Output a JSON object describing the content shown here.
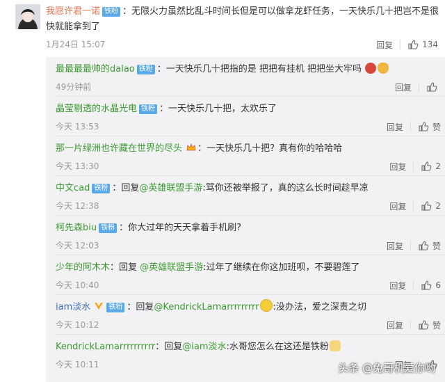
{
  "main": {
    "user": "我愿许君一诺",
    "badge": "铁粉",
    "text": "：无限火力虽然比乱斗时间长但是可以做拿龙虾任务，一天快乐几十把岂不是很快就能拿到了",
    "time": "1月24日 15:07",
    "reply": "回复",
    "likes": "134"
  },
  "replies": [
    {
      "user": "最最最最帅的dalao",
      "badge": "铁粉",
      "text": "：一天快乐几十把指的是 把把有挂机 把把坐大牢吗",
      "time": "49分钟前",
      "reply": "回复",
      "likes": ""
    },
    {
      "user": "晶莹剔透的水晶光电",
      "badge": "铁粉",
      "text": "：一天快乐几十把，太欢乐了",
      "time": "今天 13:53",
      "reply": "回复",
      "likes": "赞"
    },
    {
      "user": "那一片绿洲也许藏在世界的尽头",
      "badge": "",
      "text": "：一天快乐几十把？真有你的哈哈哈",
      "time": "今天 13:30",
      "reply": "回复",
      "likes": "2"
    },
    {
      "user": "中文cad",
      "badge": "铁粉",
      "pre": "：回复",
      "mention": "@英雄联盟手游",
      "text": ":骂你还被举报了，真的这么长时间趁早凉",
      "time": "今天 12:38",
      "reply": "回复",
      "likes": "2"
    },
    {
      "user": "柯先森biu",
      "badge": "铁粉",
      "text": "：你大过年的天天拿着手机刷?",
      "time": "今天 12:03",
      "reply": "回复",
      "likes": "赞"
    },
    {
      "user": "少年的阿木木",
      "badge": "",
      "pre": "：回复 ",
      "mention": "@英雄联盟手游",
      "text": ":过年了继续在你这加班呗，不要碧莲了",
      "time": "今天 10:40",
      "reply": "回复",
      "likes": "6"
    },
    {
      "user": "iam淡水",
      "badge": "铁粉",
      "pre": "：回复",
      "mention": "@KendrickLamarrrrrrrrr",
      "text": ":没办法，爱之深责之切",
      "time": "今天 10:12",
      "reply": "回复",
      "likes": "赞"
    },
    {
      "user": "KendrickLamarrrrrrrrrr",
      "badge": "",
      "pre": "：回复",
      "mention": "@iam淡水",
      "text": ":水哥您怎么在这还是铁粉",
      "time": "今天 10:11",
      "reply": "回复",
      "likes": ""
    }
  ],
  "watermark": "头条 @兔哥机爱你哟"
}
